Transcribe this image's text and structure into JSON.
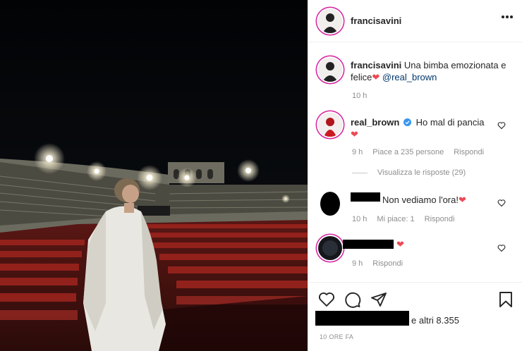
{
  "post": {
    "author": "francisavini",
    "caption_text": "Una bimba emozionata e felice",
    "caption_heart": "❤",
    "caption_mention": "@real_brown",
    "caption_time": "10 h"
  },
  "comments": [
    {
      "username": "real_brown",
      "verified": true,
      "text": "Ho mal di pancia",
      "heart": "❤",
      "time": "9 h",
      "likes": "Piace a 235 persone",
      "reply": "Rispondi",
      "view_replies": "Visualizza le risposte (29)"
    },
    {
      "username_redacted": true,
      "text": "Non vediamo l'ora!",
      "heart": "❤",
      "time": "10 h",
      "likes": "Mi piace: 1",
      "reply": "Rispondi"
    },
    {
      "username_redacted": true,
      "text": "",
      "heart": "❤",
      "time": "9 h",
      "reply": "Rispondi"
    }
  ],
  "footer": {
    "likes_text": "e altri 8.355",
    "time_ago": "10 ORE FA"
  },
  "colors": {
    "heart": "#ed4956",
    "mention": "#00376b",
    "verified": "#3897f0",
    "story_ring": "#d6249f"
  },
  "icons": [
    "more-icon",
    "heart-icon",
    "comment-icon",
    "share-icon",
    "bookmark-icon",
    "verified-badge-icon"
  ]
}
